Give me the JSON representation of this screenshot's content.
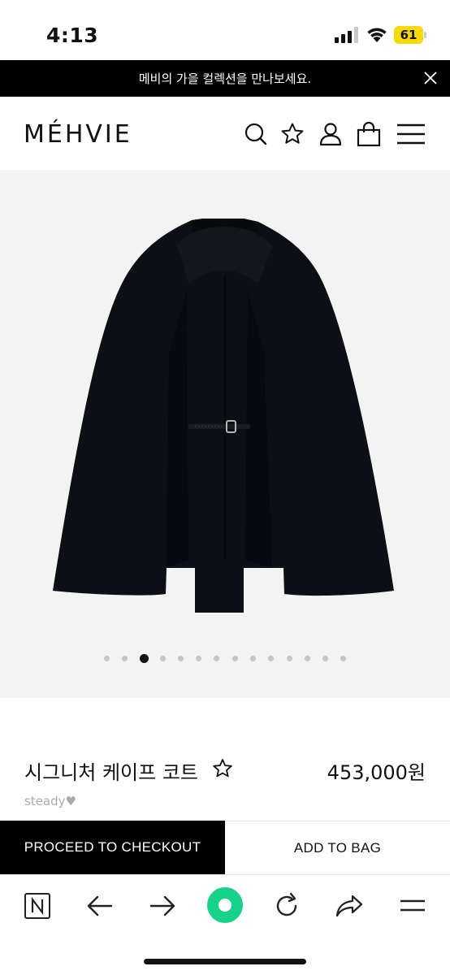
{
  "status_bar": {
    "time": "4:13",
    "battery": "61",
    "battery_color": "#f5d90a"
  },
  "banner": {
    "text": "메비의 가을 컬렉션을 만나보세요."
  },
  "header": {
    "logo": "MÉHVIE",
    "icons": [
      "search-icon",
      "star-icon",
      "user-icon",
      "bag-icon",
      "menu-icon"
    ]
  },
  "gallery": {
    "slide_count": 14,
    "active_index": 2
  },
  "product": {
    "name": "시그니처 케이프 코트",
    "price": "453,000원",
    "seller": "steady♥"
  },
  "actions": {
    "checkout": "PROCEED TO CHECKOUT",
    "add_to_bag": "ADD TO BAG"
  },
  "browser_toolbar": {
    "icons": [
      "naver-icon",
      "back-arrow-icon",
      "forward-arrow-icon",
      "green-dot-icon",
      "refresh-icon",
      "share-icon",
      "menu-icon"
    ],
    "accent": "#19d28a"
  }
}
